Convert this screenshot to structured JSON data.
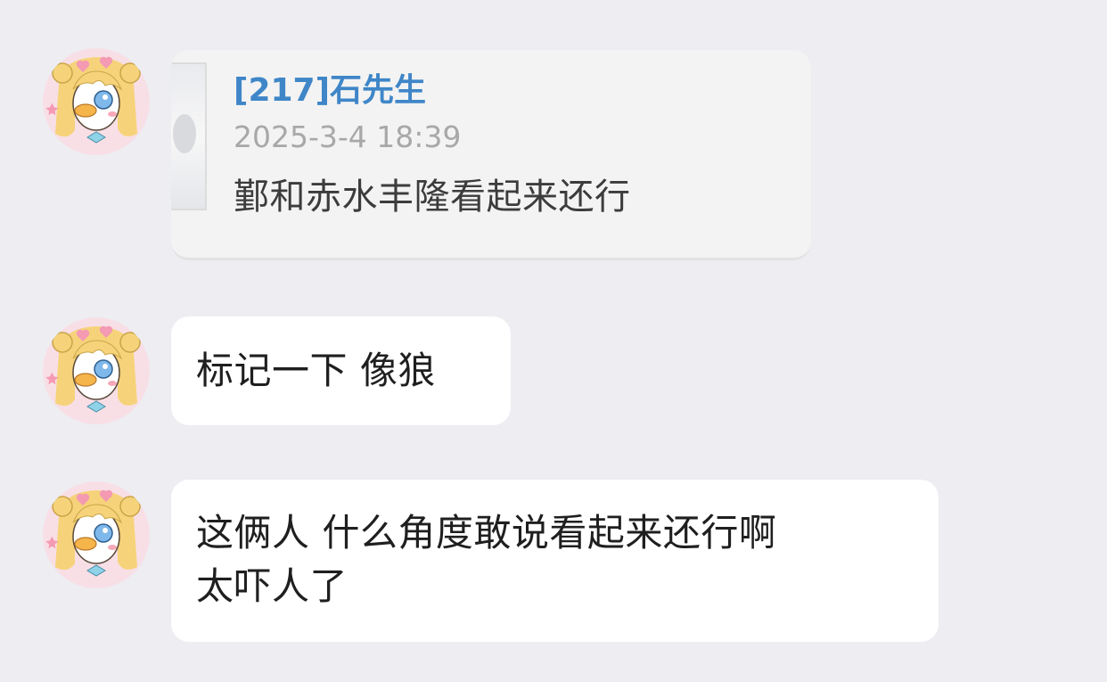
{
  "messages": [
    {
      "type": "quote",
      "quote": {
        "sender": "[217]石先生",
        "time": "2025-3-4 18:39",
        "text": "鄞和赤水丰隆看起来还行"
      }
    },
    {
      "type": "text",
      "lines": [
        "标记一下 像狼"
      ]
    },
    {
      "type": "text",
      "lines": [
        "这俩人 什么角度敢说看起来还行啊",
        "太吓人了"
      ]
    }
  ],
  "colors": {
    "background": "#ededf2",
    "bubble": "#ffffff",
    "quote_card": "#f3f3f3",
    "quote_sender": "#3f86c8",
    "quote_time": "#a8a8a8",
    "text": "#1f1f1f"
  },
  "icons": {
    "avatar": "cartoon-duck-with-blonde-hair-avatar"
  }
}
